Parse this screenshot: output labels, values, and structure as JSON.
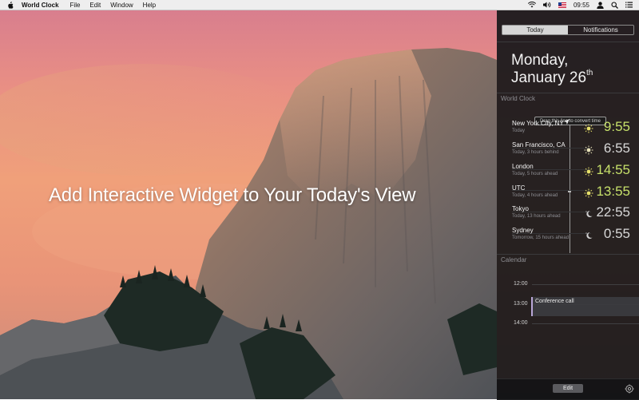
{
  "menubar": {
    "app_name": "World Clock",
    "menus": [
      "File",
      "Edit",
      "Window",
      "Help"
    ],
    "clock": "09:55"
  },
  "headline": "Add Interactive Widget to Your Today's View",
  "panel": {
    "tabs": [
      {
        "label": "Today",
        "active": true
      },
      {
        "label": "Notifications",
        "active": false
      }
    ],
    "date_weekday": "Monday,",
    "date_day": "January 26",
    "date_suffix": "th",
    "world_clock": {
      "section_title": "World Clock",
      "drag_hint": "Drag this line to convert time",
      "rows": [
        {
          "city": "New York City, NY",
          "sub": "Today",
          "time": "9:55",
          "period": "day",
          "current_location": true
        },
        {
          "city": "San Francisco, CA",
          "sub": "Today, 3 hours behind",
          "time": "6:55",
          "period": "day",
          "current_location": false
        },
        {
          "city": "London",
          "sub": "Today, 5 hours ahead",
          "time": "14:55",
          "period": "day",
          "current_location": false
        },
        {
          "city": "UTC",
          "sub": "Today, 4 hours ahead",
          "time": "13:55",
          "period": "day",
          "current_location": false
        },
        {
          "city": "Tokyo",
          "sub": "Today, 13 hours ahead",
          "time": "22:55",
          "period": "night",
          "current_location": false
        },
        {
          "city": "Sydney",
          "sub": "Tomorrow, 15 hours ahead",
          "time": "0:55",
          "period": "night",
          "current_location": false
        }
      ]
    },
    "calendar": {
      "section_title": "Calendar",
      "hours": [
        "12:00",
        "13:00",
        "14:00"
      ],
      "event": "Conference call"
    },
    "edit_label": "Edit"
  },
  "colors": {
    "day_time": "#c6e06a",
    "night_time": "#d8d8d8",
    "panel_bg": "#18181a",
    "event_accent": "#b9a7d8"
  },
  "icons": {
    "menubar": [
      "apple-icon",
      "wifi-icon",
      "volume-icon",
      "flag-icon",
      "user-icon",
      "search-icon",
      "list-icon"
    ],
    "rows": [
      "sun-icon",
      "moon-icon",
      "location-arrow-icon"
    ],
    "footer": [
      "gear-icon"
    ]
  }
}
